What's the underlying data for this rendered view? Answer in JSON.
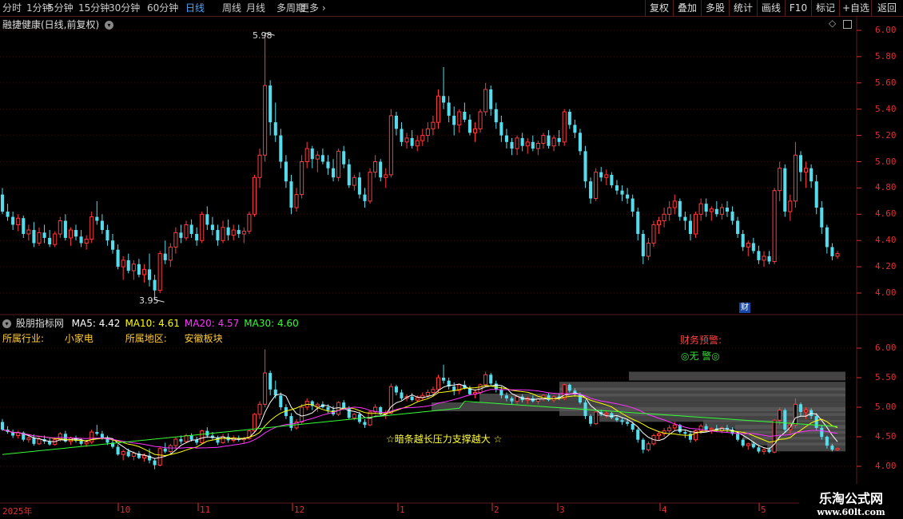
{
  "toolbar": {
    "periods": [
      {
        "label": "分时",
        "active": false
      },
      {
        "label": "1分钟",
        "active": false
      },
      {
        "label": "5分钟",
        "active": false
      },
      {
        "label": "15分钟",
        "active": false
      },
      {
        "label": "30分钟",
        "active": false
      },
      {
        "label": "60分钟",
        "active": false
      },
      {
        "label": "日线",
        "active": true
      },
      {
        "label": "周线",
        "active": false
      },
      {
        "label": "月线",
        "active": false
      },
      {
        "label": "多周期",
        "active": false
      },
      {
        "label": "更多",
        "active": false
      }
    ],
    "tools": [
      "复权",
      "叠加",
      "多股",
      "统计",
      "画线",
      "F10",
      "标记",
      "+自选",
      "返回"
    ]
  },
  "main_pane": {
    "title": "融捷健康(日线,前复权)",
    "high_marker": "5.98",
    "low_marker": "3.95",
    "fin_badge": "财",
    "y_ticks": [
      "6.00",
      "5.80",
      "5.60",
      "5.40",
      "5.20",
      "5.00",
      "4.80",
      "4.60",
      "4.40",
      "4.20",
      "4.00"
    ]
  },
  "indicator_pane": {
    "name": "股朋指标网",
    "ma": [
      {
        "label": "MA5: 4.42",
        "color": "#ffffff"
      },
      {
        "label": "MA10: 4.61",
        "color": "#ffff00"
      },
      {
        "label": "MA20: 4.57",
        "color": "#ff33ff"
      },
      {
        "label": "MA30: 4.60",
        "color": "#33ff33"
      }
    ],
    "industry_label": "所属行业:",
    "industry_value": "小家电",
    "region_label": "所属地区:",
    "region_value": "安徽板块",
    "warning_label": "财务预警:",
    "warning_value": "◎无 警◎",
    "annotation": "☆暗条越长压力支撑越大 ☆",
    "y_ticks": [
      "6.00",
      "5.50",
      "5.00",
      "4.50",
      "4.00"
    ]
  },
  "time_axis": {
    "labels": [
      "2025年",
      "10",
      "11",
      "12",
      "1",
      "2",
      "3",
      "4",
      "5"
    ]
  },
  "watermark": {
    "title": "乐淘公式网",
    "url": "www.60lt.com"
  },
  "colors": {
    "up": "#ff3c3c",
    "down": "#55ddee",
    "grid": "#5a1a1a",
    "axis": "#e03030",
    "ma5": "#ffffff",
    "ma10": "#ffff00",
    "ma20": "#ff33ff",
    "ma30": "#33ff33"
  },
  "chart_data": {
    "type": "candlestick",
    "y_range_main": [
      3.9,
      6.05
    ],
    "y_range_indicator": [
      3.85,
      6.3
    ],
    "candles": [
      [
        4.75,
        4.8,
        4.6,
        4.62
      ],
      [
        4.62,
        4.68,
        4.55,
        4.58
      ],
      [
        4.58,
        4.62,
        4.48,
        4.52
      ],
      [
        4.52,
        4.6,
        4.47,
        4.57
      ],
      [
        4.57,
        4.59,
        4.42,
        4.45
      ],
      [
        4.45,
        4.52,
        4.4,
        4.48
      ],
      [
        4.48,
        4.54,
        4.35,
        4.38
      ],
      [
        4.38,
        4.5,
        4.36,
        4.46
      ],
      [
        4.46,
        4.52,
        4.38,
        4.42
      ],
      [
        4.42,
        4.48,
        4.35,
        4.37
      ],
      [
        4.37,
        4.47,
        4.35,
        4.45
      ],
      [
        4.45,
        4.58,
        4.42,
        4.55
      ],
      [
        4.55,
        4.6,
        4.4,
        4.42
      ],
      [
        4.42,
        4.5,
        4.36,
        4.48
      ],
      [
        4.48,
        4.52,
        4.4,
        4.43
      ],
      [
        4.43,
        4.48,
        4.35,
        4.38
      ],
      [
        4.38,
        4.44,
        4.33,
        4.41
      ],
      [
        4.41,
        4.62,
        4.38,
        4.58
      ],
      [
        4.58,
        4.7,
        4.52,
        4.55
      ],
      [
        4.55,
        4.6,
        4.45,
        4.48
      ],
      [
        4.48,
        4.52,
        4.36,
        4.4
      ],
      [
        4.4,
        4.45,
        4.3,
        4.33
      ],
      [
        4.33,
        4.37,
        4.18,
        4.2
      ],
      [
        4.2,
        4.28,
        4.1,
        4.25
      ],
      [
        4.25,
        4.3,
        4.15,
        4.17
      ],
      [
        4.17,
        4.25,
        4.1,
        4.22
      ],
      [
        4.22,
        4.26,
        4.12,
        4.14
      ],
      [
        4.14,
        4.22,
        4.08,
        4.18
      ],
      [
        4.18,
        4.3,
        4.05,
        4.1
      ],
      [
        4.1,
        4.14,
        3.95,
        4.02
      ],
      [
        4.02,
        4.32,
        4.0,
        4.3
      ],
      [
        4.3,
        4.4,
        4.22,
        4.25
      ],
      [
        4.25,
        4.38,
        4.2,
        4.35
      ],
      [
        4.35,
        4.5,
        4.3,
        4.46
      ],
      [
        4.46,
        4.52,
        4.38,
        4.42
      ],
      [
        4.42,
        4.55,
        4.4,
        4.52
      ],
      [
        4.52,
        4.56,
        4.42,
        4.45
      ],
      [
        4.45,
        4.5,
        4.36,
        4.4
      ],
      [
        4.4,
        4.62,
        4.38,
        4.6
      ],
      [
        4.6,
        4.66,
        4.48,
        4.52
      ],
      [
        4.52,
        4.58,
        4.44,
        4.48
      ],
      [
        4.48,
        4.52,
        4.36,
        4.4
      ],
      [
        4.4,
        4.55,
        4.38,
        4.5
      ],
      [
        4.5,
        4.56,
        4.4,
        4.44
      ],
      [
        4.44,
        4.52,
        4.4,
        4.48
      ],
      [
        4.48,
        4.52,
        4.42,
        4.45
      ],
      [
        4.45,
        4.5,
        4.38,
        4.47
      ],
      [
        4.47,
        4.62,
        4.45,
        4.6
      ],
      [
        4.6,
        4.9,
        4.58,
        4.88
      ],
      [
        4.88,
        5.1,
        4.8,
        5.05
      ],
      [
        5.05,
        5.98,
        5.0,
        5.58
      ],
      [
        5.58,
        5.62,
        5.2,
        5.3
      ],
      [
        5.3,
        5.45,
        5.15,
        5.2
      ],
      [
        5.2,
        5.25,
        4.95,
        5.0
      ],
      [
        5.0,
        5.05,
        4.8,
        4.85
      ],
      [
        4.85,
        4.9,
        4.6,
        4.65
      ],
      [
        4.65,
        4.8,
        4.62,
        4.75
      ],
      [
        4.75,
        5.05,
        4.72,
        5.0
      ],
      [
        5.0,
        5.15,
        4.95,
        5.1
      ],
      [
        5.1,
        5.12,
        4.95,
        5.02
      ],
      [
        5.02,
        5.08,
        4.92,
        5.05
      ],
      [
        5.05,
        5.1,
        4.98,
        5.0
      ],
      [
        5.0,
        5.05,
        4.9,
        4.95
      ],
      [
        4.95,
        5.02,
        4.85,
        4.88
      ],
      [
        4.88,
        5.1,
        4.85,
        5.08
      ],
      [
        5.08,
        5.12,
        4.95,
        4.98
      ],
      [
        4.98,
        5.02,
        4.8,
        4.82
      ],
      [
        4.82,
        4.9,
        4.78,
        4.88
      ],
      [
        4.88,
        4.92,
        4.72,
        4.75
      ],
      [
        4.75,
        4.8,
        4.65,
        4.7
      ],
      [
        4.7,
        4.95,
        4.68,
        4.92
      ],
      [
        4.92,
        5.05,
        4.88,
        5.0
      ],
      [
        5.0,
        5.02,
        4.85,
        4.88
      ],
      [
        4.88,
        4.95,
        4.8,
        4.9
      ],
      [
        4.9,
        5.4,
        4.88,
        5.35
      ],
      [
        5.35,
        5.38,
        5.2,
        5.25
      ],
      [
        5.25,
        5.3,
        5.12,
        5.15
      ],
      [
        5.15,
        5.22,
        5.1,
        5.18
      ],
      [
        5.18,
        5.24,
        5.1,
        5.12
      ],
      [
        5.12,
        5.2,
        5.08,
        5.16
      ],
      [
        5.16,
        5.25,
        5.12,
        5.2
      ],
      [
        5.2,
        5.3,
        5.15,
        5.25
      ],
      [
        5.25,
        5.35,
        5.2,
        5.3
      ],
      [
        5.3,
        5.55,
        5.25,
        5.5
      ],
      [
        5.5,
        5.72,
        5.4,
        5.45
      ],
      [
        5.45,
        5.5,
        5.3,
        5.35
      ],
      [
        5.35,
        5.42,
        5.2,
        5.28
      ],
      [
        5.28,
        5.4,
        5.22,
        5.38
      ],
      [
        5.38,
        5.45,
        5.3,
        5.32
      ],
      [
        5.32,
        5.36,
        5.2,
        5.22
      ],
      [
        5.22,
        5.3,
        5.15,
        5.25
      ],
      [
        5.25,
        5.4,
        5.22,
        5.38
      ],
      [
        5.38,
        5.6,
        5.35,
        5.55
      ],
      [
        5.55,
        5.58,
        5.35,
        5.4
      ],
      [
        5.4,
        5.45,
        5.25,
        5.3
      ],
      [
        5.3,
        5.35,
        5.15,
        5.2
      ],
      [
        5.2,
        5.25,
        5.1,
        5.15
      ],
      [
        5.15,
        5.18,
        5.05,
        5.1
      ],
      [
        5.1,
        5.2,
        5.05,
        5.18
      ],
      [
        5.18,
        5.22,
        5.08,
        5.12
      ],
      [
        5.12,
        5.18,
        5.06,
        5.15
      ],
      [
        5.15,
        5.2,
        5.08,
        5.1
      ],
      [
        5.1,
        5.16,
        5.05,
        5.14
      ],
      [
        5.14,
        5.22,
        5.1,
        5.2
      ],
      [
        5.2,
        5.24,
        5.1,
        5.12
      ],
      [
        5.12,
        5.2,
        5.08,
        5.18
      ],
      [
        5.18,
        5.24,
        5.12,
        5.15
      ],
      [
        5.15,
        5.4,
        5.12,
        5.38
      ],
      [
        5.38,
        5.4,
        5.25,
        5.28
      ],
      [
        5.28,
        5.32,
        5.18,
        5.22
      ],
      [
        5.22,
        5.25,
        5.05,
        5.08
      ],
      [
        5.08,
        5.12,
        4.8,
        4.85
      ],
      [
        4.85,
        4.88,
        4.68,
        4.72
      ],
      [
        4.72,
        4.95,
        4.7,
        4.92
      ],
      [
        4.92,
        4.96,
        4.85,
        4.88
      ],
      [
        4.88,
        4.94,
        4.82,
        4.9
      ],
      [
        4.9,
        4.92,
        4.8,
        4.82
      ],
      [
        4.82,
        4.86,
        4.75,
        4.78
      ],
      [
        4.78,
        4.82,
        4.7,
        4.75
      ],
      [
        4.75,
        4.8,
        4.68,
        4.72
      ],
      [
        4.72,
        4.75,
        4.58,
        4.62
      ],
      [
        4.62,
        4.65,
        4.4,
        4.45
      ],
      [
        4.45,
        4.48,
        4.22,
        4.28
      ],
      [
        4.28,
        4.42,
        4.25,
        4.38
      ],
      [
        4.38,
        4.55,
        4.35,
        4.52
      ],
      [
        4.52,
        4.58,
        4.45,
        4.55
      ],
      [
        4.55,
        4.65,
        4.5,
        4.6
      ],
      [
        4.6,
        4.7,
        4.55,
        4.65
      ],
      [
        4.65,
        4.75,
        4.6,
        4.7
      ],
      [
        4.7,
        4.72,
        4.55,
        4.58
      ],
      [
        4.58,
        4.62,
        4.48,
        4.55
      ],
      [
        4.55,
        4.6,
        4.4,
        4.45
      ],
      [
        4.45,
        4.62,
        4.42,
        4.6
      ],
      [
        4.6,
        4.72,
        4.55,
        4.68
      ],
      [
        4.68,
        4.72,
        4.58,
        4.62
      ],
      [
        4.62,
        4.66,
        4.55,
        4.64
      ],
      [
        4.64,
        4.7,
        4.58,
        4.6
      ],
      [
        4.6,
        4.68,
        4.56,
        4.65
      ],
      [
        4.65,
        4.7,
        4.58,
        4.62
      ],
      [
        4.62,
        4.66,
        4.52,
        4.55
      ],
      [
        4.55,
        4.58,
        4.42,
        4.45
      ],
      [
        4.45,
        4.48,
        4.32,
        4.35
      ],
      [
        4.35,
        4.4,
        4.28,
        4.38
      ],
      [
        4.38,
        4.42,
        4.3,
        4.32
      ],
      [
        4.32,
        4.36,
        4.22,
        4.25
      ],
      [
        4.25,
        4.32,
        4.2,
        4.28
      ],
      [
        4.28,
        4.32,
        4.22,
        4.24
      ],
      [
        4.24,
        4.8,
        4.22,
        4.78
      ],
      [
        4.78,
        5.0,
        4.7,
        4.95
      ],
      [
        4.95,
        4.98,
        4.58,
        4.62
      ],
      [
        4.62,
        4.75,
        4.55,
        4.7
      ],
      [
        4.7,
        5.15,
        4.65,
        5.05
      ],
      [
        5.05,
        5.08,
        4.85,
        4.92
      ],
      [
        4.92,
        5.0,
        4.8,
        4.95
      ],
      [
        4.95,
        4.98,
        4.8,
        4.85
      ],
      [
        4.85,
        4.9,
        4.6,
        4.65
      ],
      [
        4.65,
        4.7,
        4.45,
        4.5
      ],
      [
        4.5,
        4.52,
        4.3,
        4.35
      ],
      [
        4.35,
        4.38,
        4.25,
        4.28
      ],
      [
        4.28,
        4.32,
        4.26,
        4.3
      ]
    ]
  }
}
